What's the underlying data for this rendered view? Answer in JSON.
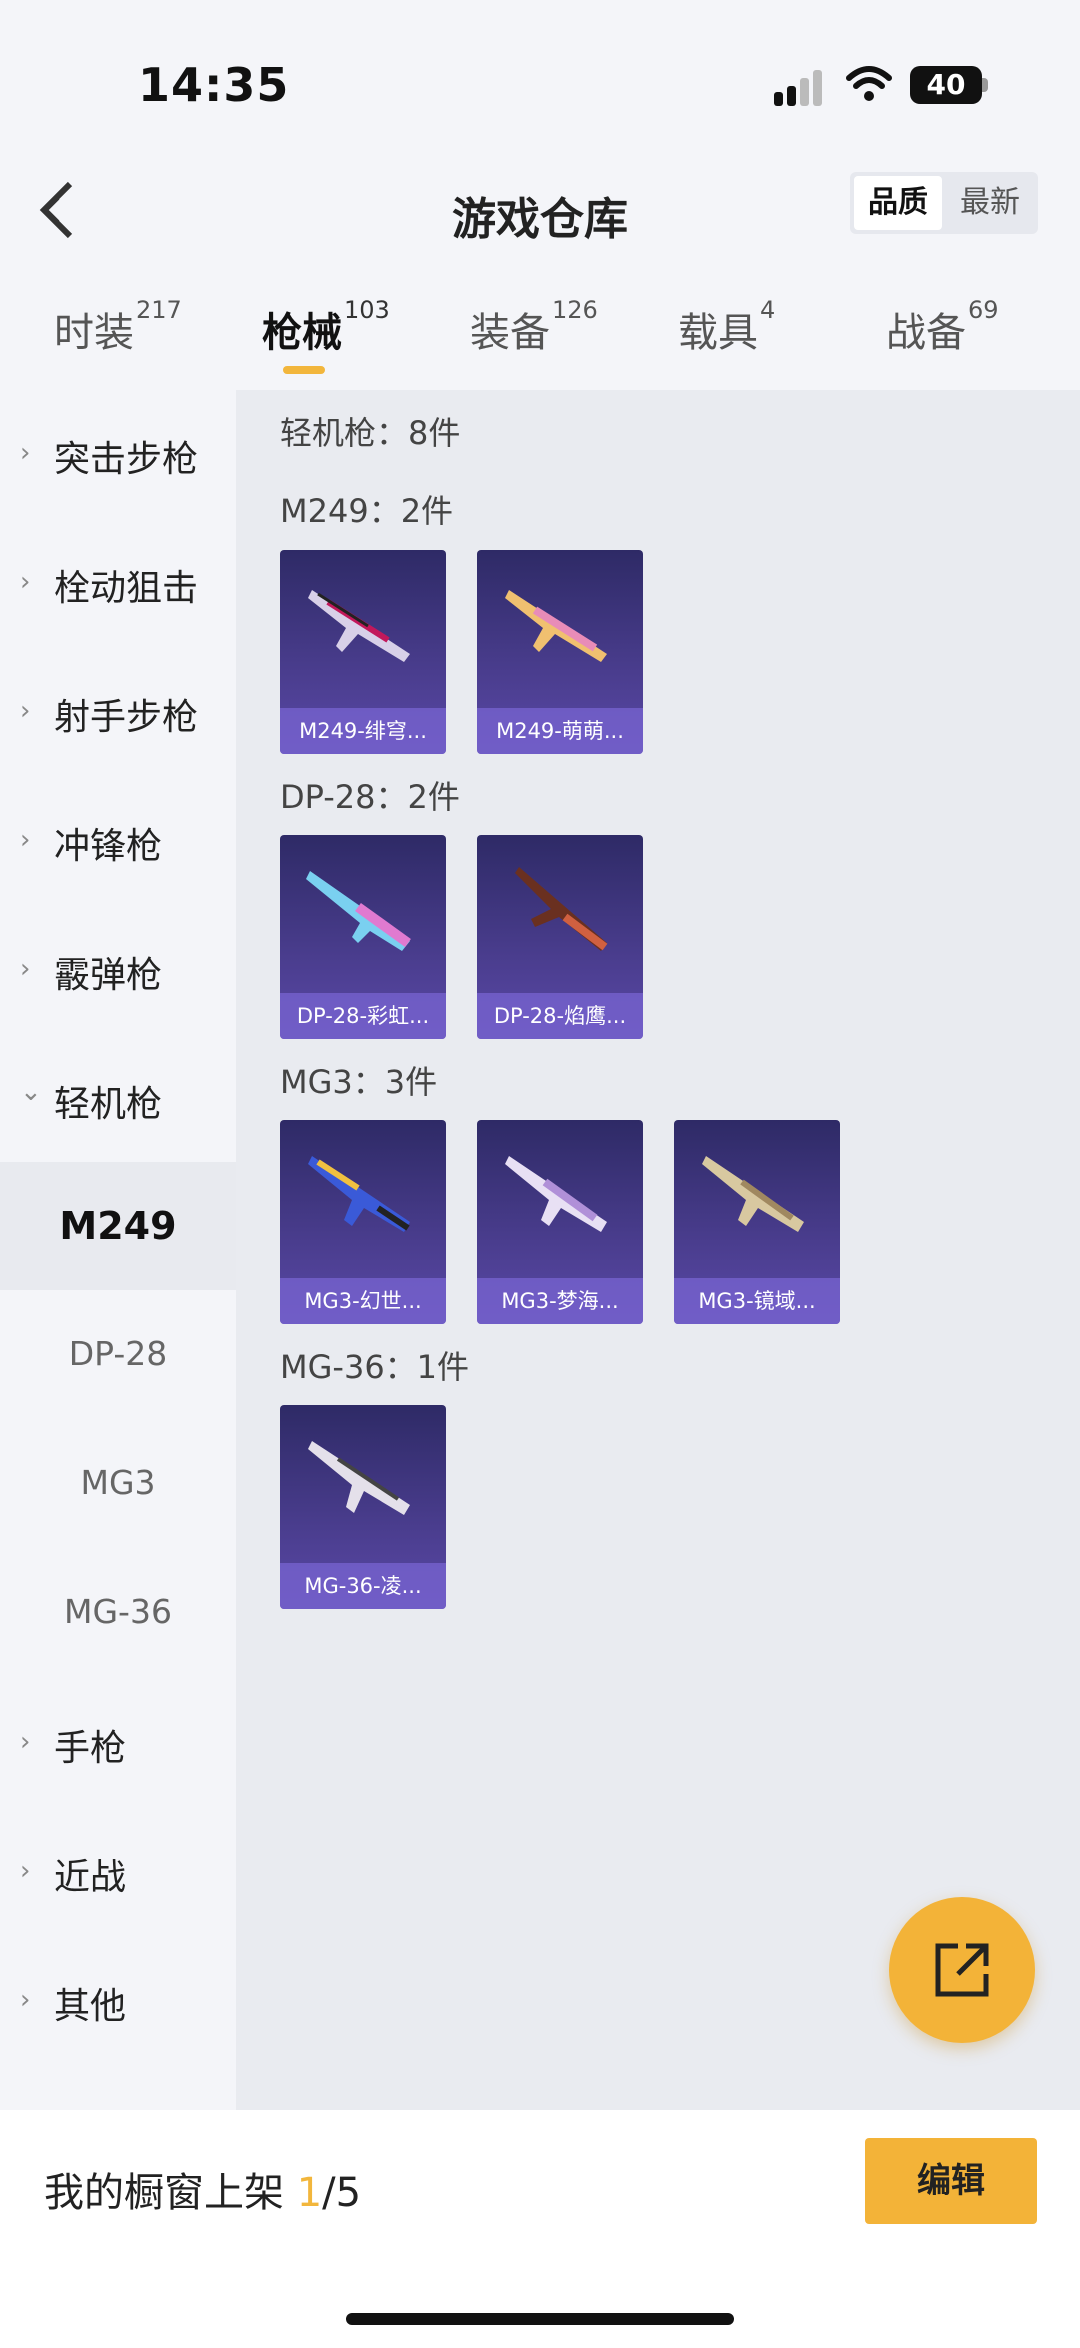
{
  "status": {
    "time": "14:35",
    "battery": "40"
  },
  "header": {
    "title": "游戏仓库",
    "sort_options": [
      "品质",
      "最新"
    ]
  },
  "tabs": [
    {
      "label": "时装",
      "count": "217"
    },
    {
      "label": "枪械",
      "count": "103"
    },
    {
      "label": "装备",
      "count": "126"
    },
    {
      "label": "载具",
      "count": "4"
    },
    {
      "label": "战备",
      "count": "69"
    }
  ],
  "sidebar": {
    "top_categories": [
      {
        "label": "突击步枪",
        "arrow": "›"
      },
      {
        "label": "栓动狙击",
        "arrow": "›"
      },
      {
        "label": "射手步枪",
        "arrow": "›"
      },
      {
        "label": "冲锋枪",
        "arrow": "›"
      },
      {
        "label": "霰弹枪",
        "arrow": "›"
      },
      {
        "label": "轻机枪",
        "arrow": "⌄"
      }
    ],
    "sub_items": [
      "M249",
      "DP-28",
      "MG3",
      "MG-36"
    ],
    "bottom_categories": [
      {
        "label": "手枪",
        "arrow": "›"
      },
      {
        "label": "近战",
        "arrow": "›"
      },
      {
        "label": "其他",
        "arrow": "›"
      }
    ]
  },
  "main": {
    "category_header": "轻机枪：8件",
    "groups": [
      {
        "header": "M249：2件",
        "items": [
          "M249-绯穹...",
          "M249-萌萌..."
        ]
      },
      {
        "header": "DP-28：2件",
        "items": [
          "DP-28-彩虹...",
          "DP-28-焰鹰..."
        ]
      },
      {
        "header": "MG3：3件",
        "items": [
          "MG3-幻世...",
          "MG3-梦海...",
          "MG3-镜域..."
        ]
      },
      {
        "header": "MG-36：1件",
        "items": [
          "MG-36-凌..."
        ]
      }
    ]
  },
  "bottom": {
    "label": "我的橱窗上架 ",
    "current": "1",
    "total": "/5",
    "edit_label": "编辑"
  },
  "icons": {
    "back": "chevron-left-icon",
    "share": "share-external-icon"
  }
}
